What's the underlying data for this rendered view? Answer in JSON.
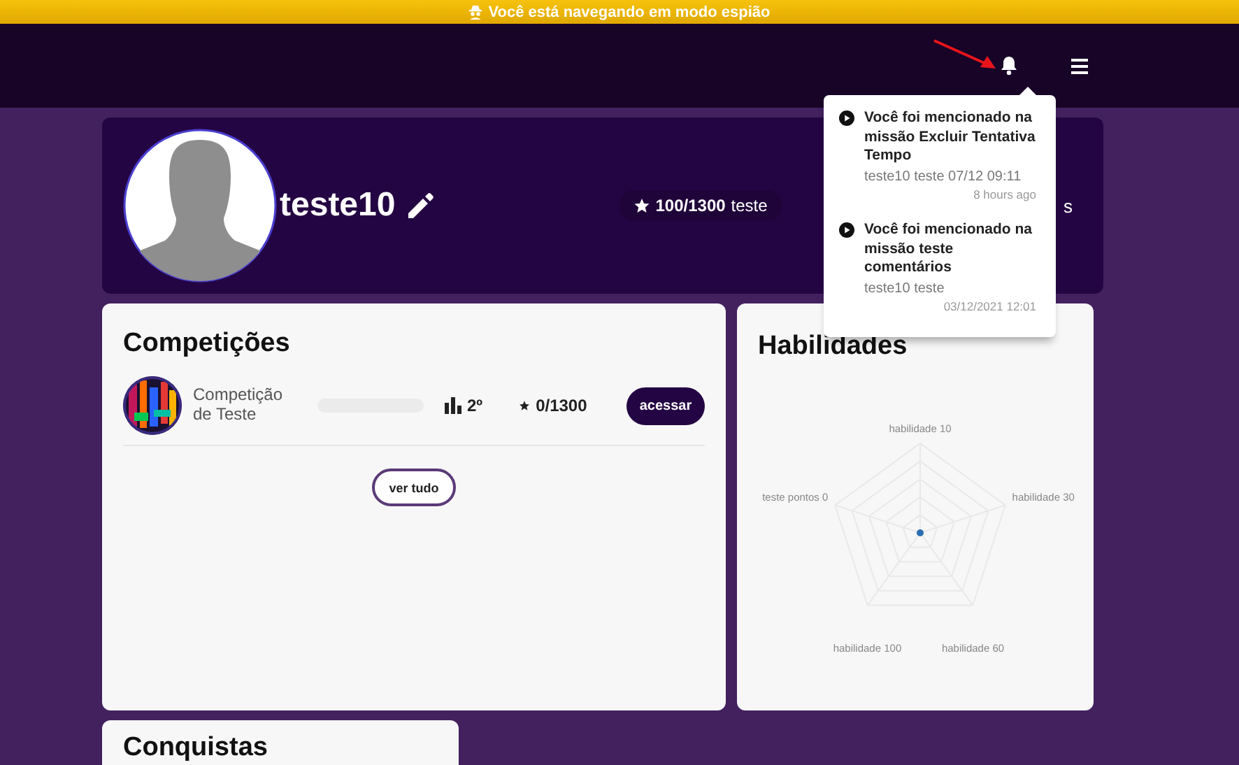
{
  "spy_banner": {
    "text": "Você está navegando em modo espião"
  },
  "profile": {
    "name": "teste10",
    "points": "100/1300",
    "points_label": "teste",
    "hidden_stat": "s"
  },
  "notifications": [
    {
      "title": "Você foi mencionado na missão Excluir Tentativa Tempo",
      "meta": "teste10 teste 07/12 09:11",
      "time": "8 hours ago"
    },
    {
      "title": "Você foi mencionado na missão teste comentários",
      "meta": "teste10 teste",
      "time": "03/12/2021 12:01"
    }
  ],
  "competitions": {
    "title": "Competições",
    "items": [
      {
        "name": "Competição de Teste",
        "level": 0,
        "rank": "2º",
        "score": "0/1300",
        "action": "acessar"
      }
    ],
    "more": "ver tudo"
  },
  "skills": {
    "title": "Habilidades",
    "labels": [
      "habilidade 10",
      "teste pontos 0",
      "habilidade 30",
      "habilidade 100",
      "habilidade 60"
    ]
  },
  "achievements": {
    "title": "Conquistas"
  }
}
